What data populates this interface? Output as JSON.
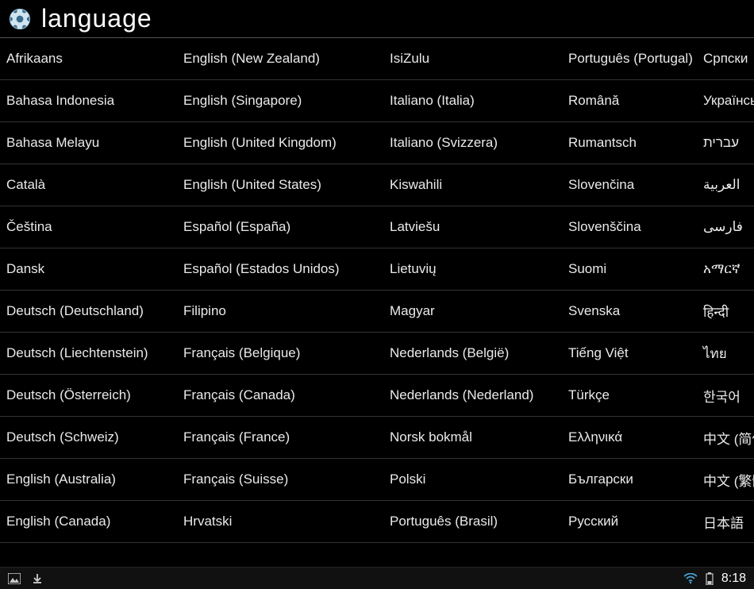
{
  "header": {
    "title": "language"
  },
  "languages": {
    "col0": [
      "Afrikaans",
      "Bahasa Indonesia",
      "Bahasa Melayu",
      "Català",
      "Čeština",
      "Dansk",
      "Deutsch (Deutschland)",
      "Deutsch (Liechtenstein)",
      "Deutsch (Österreich)",
      "Deutsch (Schweiz)",
      "English (Australia)",
      "English (Canada)"
    ],
    "col1": [
      "English (New Zealand)",
      "English (Singapore)",
      "English (United Kingdom)",
      "English (United States)",
      "Español (España)",
      "Español (Estados Unidos)",
      "Filipino",
      "Français (Belgique)",
      "Français (Canada)",
      "Français (France)",
      "Français (Suisse)",
      "Hrvatski"
    ],
    "col2": [
      "IsiZulu",
      "Italiano (Italia)",
      "Italiano (Svizzera)",
      "Kiswahili",
      "Latviešu",
      "Lietuvių",
      "Magyar",
      "Nederlands (België)",
      "Nederlands (Nederland)",
      "Norsk bokmål",
      "Polski",
      "Português (Brasil)"
    ],
    "col3": [
      "Português (Portugal)",
      "Română",
      "Rumantsch",
      "Slovenčina",
      "Slovenščina",
      "Suomi",
      "Svenska",
      "Tiếng Việt",
      "Türkçe",
      "Ελληνικά",
      "Български",
      "Русский"
    ],
    "col4": [
      "Српски",
      "Українська",
      "עברית",
      "العربية",
      "فارسی",
      "አማርኛ",
      "हिन्दी",
      "ไทย",
      "한국어",
      "中文 (简体)",
      "中文 (繁體)",
      "日本語"
    ]
  },
  "statusbar": {
    "time": "8:18"
  }
}
